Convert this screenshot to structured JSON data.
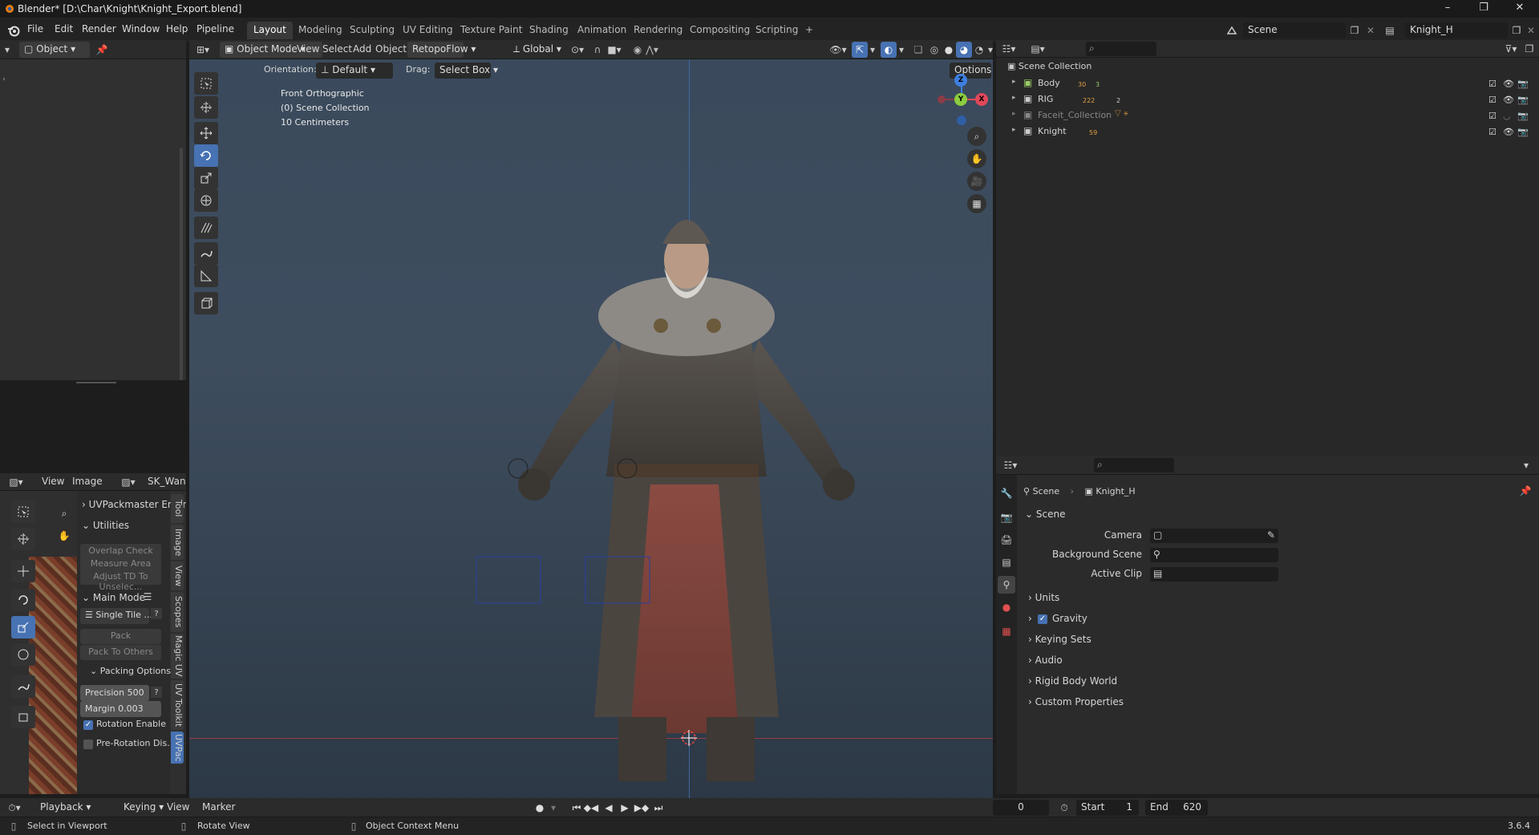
{
  "window": {
    "title": "Blender* [D:\\Char\\Knight\\Knight_Export.blend]",
    "min": "–",
    "max": "❐",
    "close": "✕"
  },
  "menu": {
    "items": [
      "File",
      "Edit",
      "Render",
      "Window",
      "Help",
      "Pipeline"
    ]
  },
  "workspaces": [
    "Layout",
    "Modeling",
    "Sculpting",
    "UV Editing",
    "Texture Paint",
    "Shading",
    "Animation",
    "Rendering",
    "Compositing",
    "Scripting",
    "+"
  ],
  "scene_selector": {
    "scene": "Scene",
    "view_layer": "Knight_H"
  },
  "left_header": {
    "mode": "Object"
  },
  "viewport_header": {
    "mode": "Object Mode",
    "view": "View",
    "select": "Select",
    "add": "Add",
    "object": "Object",
    "retopo": "RetopoFlow",
    "orientation": "Global"
  },
  "tool_header": {
    "orientation_label": "Orientation:",
    "orientation_value": "Default",
    "drag_label": "Drag:",
    "drag_value": "Select Box",
    "options": "Options"
  },
  "viewport_overlay": {
    "view_name": "Front Orthographic",
    "collection": "(0) Scene Collection",
    "scale": "10 Centimeters"
  },
  "gizmo": {
    "z": "Z",
    "y": "Y",
    "x": "X"
  },
  "outliner": {
    "root": "Scene Collection",
    "rows": [
      {
        "name": "Body",
        "badges": [
          "30",
          "3"
        ]
      },
      {
        "name": "RIG",
        "badges": [
          "222",
          "2"
        ]
      },
      {
        "name": "Faceit_Collection",
        "badges": []
      },
      {
        "name": "Knight",
        "badges": [
          "59"
        ]
      }
    ]
  },
  "uv_editor": {
    "view": "View",
    "image": "Image",
    "image_name": "SK_Wandering_Knig",
    "uvpackmaster": "UVPackmaster Engin",
    "utilities": "Utilities",
    "overlap_check": "Overlap Check",
    "measure_area": "Measure Area",
    "adjust_td": "Adjust TD To Unselec...",
    "main_mode": "Main Mode",
    "single_tile": "Single Tile ...",
    "pack": "Pack",
    "pack_to_others": "Pack To Others",
    "packing_options": "Packing Options",
    "precision_label": "Precision",
    "precision_value": "500",
    "margin_label": "Margin",
    "margin_value": "0.003",
    "rotation_enable": "Rotation Enable",
    "pre_rotation": "Pre-Rotation Dis...",
    "tabs": [
      "Tool",
      "Image",
      "View",
      "Scopes",
      "Magic UV",
      "UV Toolkit",
      "UVPac"
    ]
  },
  "properties": {
    "breadcrumb_scene": "Scene",
    "breadcrumb_object": "Knight_H",
    "section": "Scene",
    "camera": "Camera",
    "background_scene": "Background Scene",
    "active_clip": "Active Clip",
    "subsections": [
      "Units",
      "Gravity",
      "Keying Sets",
      "Audio",
      "Rigid Body World",
      "Custom Properties"
    ]
  },
  "timeline": {
    "playback": "Playback",
    "keying": "Keying",
    "view": "View",
    "marker": "Marker",
    "current_frame": "0",
    "start_label": "Start",
    "start": "1",
    "end_label": "End",
    "end": "620"
  },
  "status": {
    "select": "Select in Viewport",
    "rotate": "Rotate View",
    "context": "Object Context Menu",
    "version": "3.6.4"
  },
  "colors": {
    "accent": "#4772b3",
    "x_axis": "#e1485a",
    "y_axis": "#8ccc3f",
    "z_axis": "#3d7fe0"
  }
}
